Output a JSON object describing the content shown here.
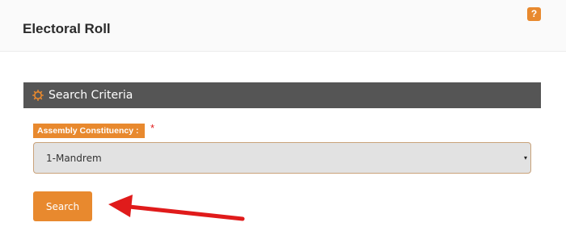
{
  "header": {
    "title": "Electoral Roll",
    "help_icon": "question-icon",
    "help_label": "?"
  },
  "panel": {
    "title": "Search Criteria",
    "icon": "gear-icon"
  },
  "form": {
    "constituency_label": "Assembly Constituency :",
    "required_mark": "*",
    "constituency_value": "1-Mandrem",
    "caret": "▾",
    "search_label": "Search"
  },
  "colors": {
    "accent": "#e8892e",
    "panel_header": "#555555",
    "arrow": "#e01b1b"
  }
}
